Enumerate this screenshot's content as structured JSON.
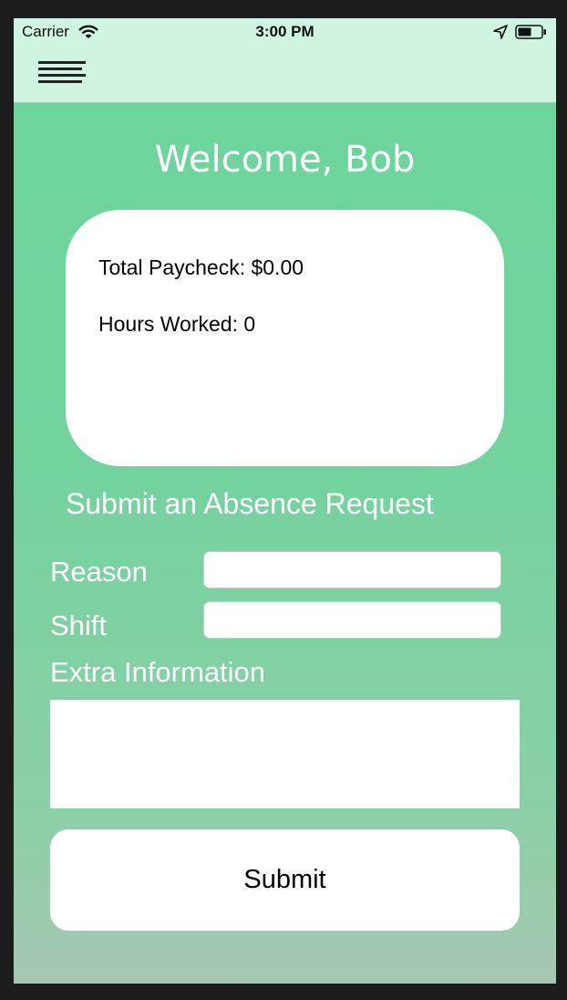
{
  "status_bar": {
    "carrier": "Carrier",
    "time": "3:00 PM",
    "icons": [
      "wifi-icon",
      "location-arrow-icon",
      "battery-icon"
    ]
  },
  "nav": {
    "menu_icon": "hamburger-menu-icon"
  },
  "welcome": {
    "text": "Welcome, Bob"
  },
  "summary": {
    "total_paycheck": "Total Paycheck: $0.00",
    "hours_worked": "Hours Worked: 0"
  },
  "absence_form": {
    "title": "Submit an Absence Request",
    "reason_label": "Reason",
    "reason_value": "",
    "shift_label": "Shift",
    "shift_value": "",
    "extra_label": "Extra Information",
    "extra_value": "",
    "submit_label": "Submit"
  },
  "colors": {
    "bar_background": "#cff4e0",
    "gradient_top": "#6bd69c",
    "gradient_bottom": "#a6c7b2",
    "card_background": "#ffffff",
    "label_text": "#ffffff"
  }
}
